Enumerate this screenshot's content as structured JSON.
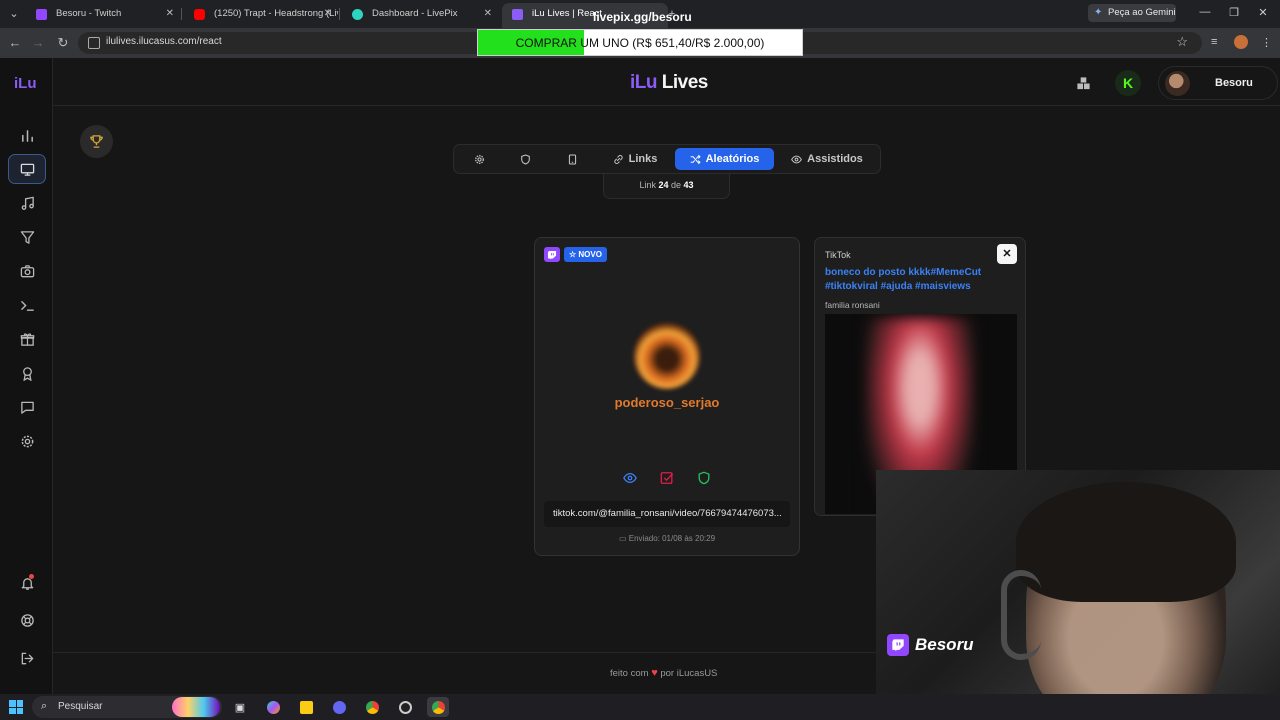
{
  "browser": {
    "tabs": [
      {
        "title": "Besoru - Twitch",
        "favicon_color": "#9146ff"
      },
      {
        "title": "(1250) Trapt - Headstrong (Live",
        "favicon_color": "#ff0000"
      },
      {
        "title": "Dashboard - LivePix",
        "favicon_color": "#2dd4bf"
      },
      {
        "title": "iLu Lives | React",
        "favicon_color": "#8b5cf6"
      }
    ],
    "gemini_label": "Peça ao Gemini",
    "url": "ilulives.ilucasus.com/react"
  },
  "stream_overlay": {
    "livepix_title": "livepix.gg/besoru",
    "goal_text": "COMPRAR UM UNO (R$ 651,40/R$ 2.000,00)",
    "goal_progress": 0.3257,
    "webcam_name": "Besoru"
  },
  "app": {
    "brand": "iLu",
    "logo_part1": "iLu",
    "logo_part2": "Lives",
    "user_name": "Besoru",
    "tabs": {
      "links": "Links",
      "aleatorios": "Aleatórios",
      "assistidos": "Assistidos"
    },
    "counter": {
      "prefix": "Link",
      "current": "24",
      "sep": "de",
      "total": "43"
    },
    "card": {
      "badge_new": "NOVO",
      "username": "poderoso_serjao",
      "link": "tiktok.com/@familia_ronsani/video/76679474476073...",
      "sent": "Enviado: 01/08 às 20:29"
    },
    "tiktok_card": {
      "platform": "TikTok",
      "title": "boneco do posto kkkk#MemeCut #tiktokviral #ajuda #maisviews",
      "author": "familia ronsani"
    },
    "footer": {
      "prefix": "feito com",
      "suffix": "por iLucasUS"
    }
  },
  "taskbar": {
    "search_placeholder": "Pesquisar"
  }
}
